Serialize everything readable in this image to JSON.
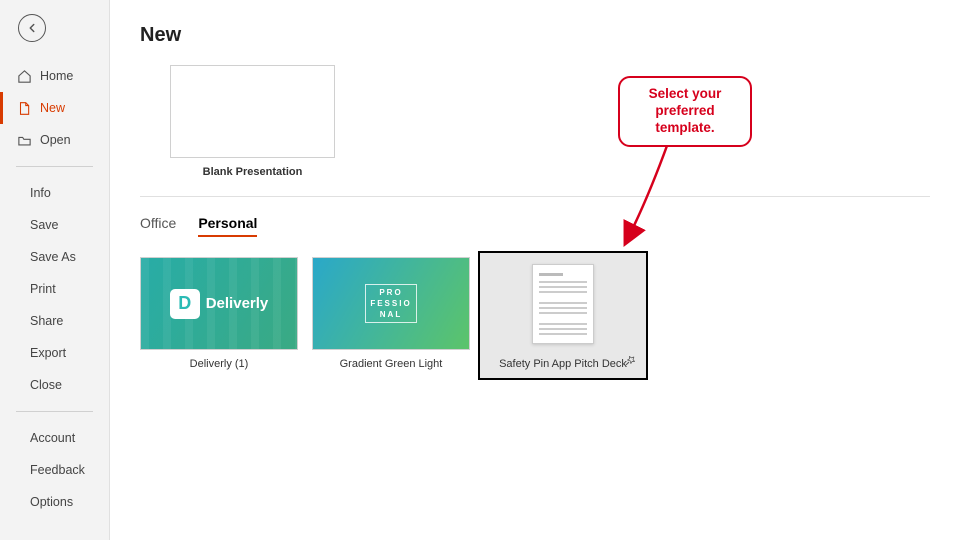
{
  "sidebar": {
    "nav": [
      {
        "label": "Home"
      },
      {
        "label": "New"
      },
      {
        "label": "Open"
      }
    ],
    "sub1": [
      {
        "label": "Info"
      },
      {
        "label": "Save"
      },
      {
        "label": "Save As"
      },
      {
        "label": "Print"
      },
      {
        "label": "Share"
      },
      {
        "label": "Export"
      },
      {
        "label": "Close"
      }
    ],
    "sub2": [
      {
        "label": "Account"
      },
      {
        "label": "Feedback"
      },
      {
        "label": "Options"
      }
    ]
  },
  "main": {
    "title": "New",
    "blank_label": "Blank Presentation",
    "tabs": [
      {
        "label": "Office"
      },
      {
        "label": "Personal"
      }
    ],
    "templates": [
      {
        "label": "Deliverly (1)",
        "logo_letter": "D",
        "logo_text": "Deliverly"
      },
      {
        "label": "Gradient Green Light",
        "text_lines": "PRO\nFESSIO\nNAL"
      },
      {
        "label": "Safety Pin App Pitch Deck"
      }
    ]
  },
  "callout": {
    "text": "Select your preferred template."
  }
}
